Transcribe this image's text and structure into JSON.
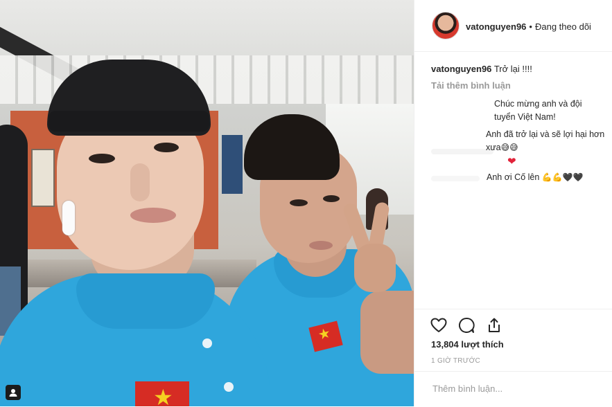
{
  "post": {
    "username": "vatonguyen96",
    "follow_status": "Đang theo dõi",
    "caption_text": "Trở lại !!!!",
    "load_more": "Tải thêm bình luận",
    "comments": [
      {
        "text": "Chúc mừng anh và đội tuyển Việt Nam!"
      },
      {
        "text": "Anh đã trở lại và sẽ lợi hại hơn xưa",
        "emoji": "😅😅"
      },
      {
        "text": "",
        "emoji": "❤"
      },
      {
        "text": "Anh ơi Cố lên",
        "emoji": "💪💪🖤🖤"
      }
    ],
    "likes": "13,804 lượt thích",
    "timestamp": "1 GIỜ TRƯỚC",
    "add_comment_placeholder": "Thêm bình luận..."
  },
  "icons": {
    "like": "heart-icon",
    "comment": "comment-icon",
    "share": "share-icon",
    "photo_badge": "person-tag-icon"
  },
  "colors": {
    "text": "#262626",
    "muted": "#999999",
    "heart": "#e2233a",
    "shirt": "#2fa6dc",
    "flag": "#d62c24"
  }
}
